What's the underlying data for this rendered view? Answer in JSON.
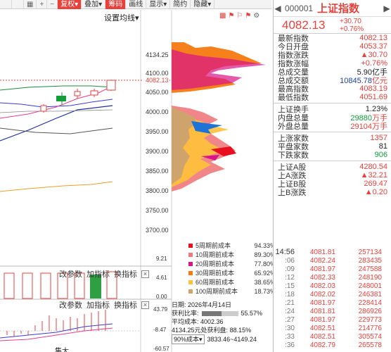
{
  "toolbar": {
    "restore_label": "复权",
    "overlay_label": "叠加",
    "chips_label": "筹码",
    "draw_label": "画线",
    "display_label": "显示",
    "simple_label": "简约",
    "hide_label": "隐藏",
    "set_ma_label": "设置均线"
  },
  "price_axis": {
    "labels": [
      "4134.25",
      "4100.00",
      "4082.13",
      "4050.00",
      "4000.00",
      "3950.00",
      "3900.00",
      "3850.00",
      "3800.00",
      "3750.00",
      "3700.00"
    ]
  },
  "pane2": {
    "modify_params": "改参数",
    "add_indicator": "加指标",
    "switch_indicator": "换指标",
    "axis": [
      "9.21",
      "4.61",
      "0.00"
    ]
  },
  "pane3": {
    "modify_params": "改参数",
    "add_indicator": "加指标",
    "switch_indicator": "换指标",
    "axis": [
      "43.79",
      "-8.47",
      "-60.57"
    ],
    "bottom_label": "集大"
  },
  "cost_legend": [
    {
      "name": "5周期前成本",
      "pct": "94.33%",
      "color": "#e8101e"
    },
    {
      "name": "10周期前成本",
      "pct": "89.30%",
      "color": "#f0797b"
    },
    {
      "name": "20周期前成本",
      "pct": "77.80%",
      "color": "#d91389"
    },
    {
      "name": "30周期前成本",
      "pct": "65.92%",
      "color": "#f57a10"
    },
    {
      "name": "60周期前成本",
      "pct": "38.65%",
      "color": "#ffc23a"
    },
    {
      "name": "100周期前成本",
      "pct": "18.73%",
      "color": "#cfa46c"
    }
  ],
  "chip_info": {
    "date": "日期: 2026年4月14日",
    "profit_label": "获利比率:",
    "profit_value": "55.57%",
    "profit_ratio": 0.5557,
    "avg_cost": "平均成本: 4002.36",
    "price_profit_prefix": "4134.25元处获利盘:",
    "price_profit_value": "88.15%",
    "cost_select": "90%成本",
    "cost_range": "3833.46~4149.24"
  },
  "quote": {
    "code": "000001",
    "name": "上证指数",
    "price": "4082.13",
    "change": "+30.70",
    "change_pct": "+0.76%",
    "rows1": [
      {
        "label": "最新指数",
        "value": "4082.13",
        "cls": "red"
      },
      {
        "label": "今日开盘",
        "value": "4053.37",
        "cls": "red"
      },
      {
        "label": "指数涨跌",
        "value": "▲30.70",
        "cls": "red"
      },
      {
        "label": "指数涨幅",
        "value": "+0.76%",
        "cls": "red"
      },
      {
        "label": "总成交量",
        "value": "5.90亿手",
        "cls": "blk"
      },
      {
        "label": "总成交额",
        "value": "10845.78",
        "unit": "亿元",
        "cls": "blue"
      },
      {
        "label": "最高指数",
        "value": "4083.19",
        "cls": "red"
      },
      {
        "label": "最低指数",
        "value": "4051.69",
        "cls": "red"
      }
    ],
    "rows2": [
      {
        "label": "上证换手",
        "value": "1.23%",
        "cls": "blk"
      },
      {
        "label": "内盘总量",
        "value": "29880",
        "unit": "万手",
        "cls": "grn"
      },
      {
        "label": "外盘总量",
        "value": "29104",
        "unit": "万手",
        "cls": "red"
      }
    ],
    "rows3": [
      {
        "label": "上涨家数",
        "value": "1357",
        "cls": "red"
      },
      {
        "label": "平盘家数",
        "value": "81",
        "cls": "blk"
      },
      {
        "label": "下跌家数",
        "value": "906",
        "cls": "grn"
      }
    ],
    "rows4": [
      {
        "label": "上证A股",
        "value": "4280.54",
        "cls": "red"
      },
      {
        "label": "上A涨跌",
        "value": "▲32.21",
        "cls": "red"
      },
      {
        "label": "上证B股",
        "value": "269.47",
        "cls": "red"
      },
      {
        "label": "上B涨跌",
        "value": "▲0.20",
        "cls": "red"
      }
    ],
    "ticks": [
      {
        "time": "14:56",
        "price": "4081.81",
        "vol": "257134"
      },
      {
        "time": ":06",
        "price": "4082.24",
        "vol": "283435"
      },
      {
        "time": ":09",
        "price": "4081.97",
        "vol": "247588"
      },
      {
        "time": ":12",
        "price": "4082.33",
        "vol": "248190"
      },
      {
        "time": ":15",
        "price": "4082.03",
        "vol": "248001"
      },
      {
        "time": ":18",
        "price": "4082.02",
        "vol": "246381"
      },
      {
        "time": ":21",
        "price": "4081.97",
        "vol": "228414"
      },
      {
        "time": ":24",
        "price": "4081.81",
        "vol": "286926"
      },
      {
        "time": ":27",
        "price": "4081.97",
        "vol": "229773"
      },
      {
        "time": ":30",
        "price": "4082.51",
        "vol": "214776"
      },
      {
        "time": ":33",
        "price": "4082.51",
        "vol": "305574"
      },
      {
        "time": ":36",
        "price": "4082.79",
        "vol": "265578"
      }
    ]
  }
}
